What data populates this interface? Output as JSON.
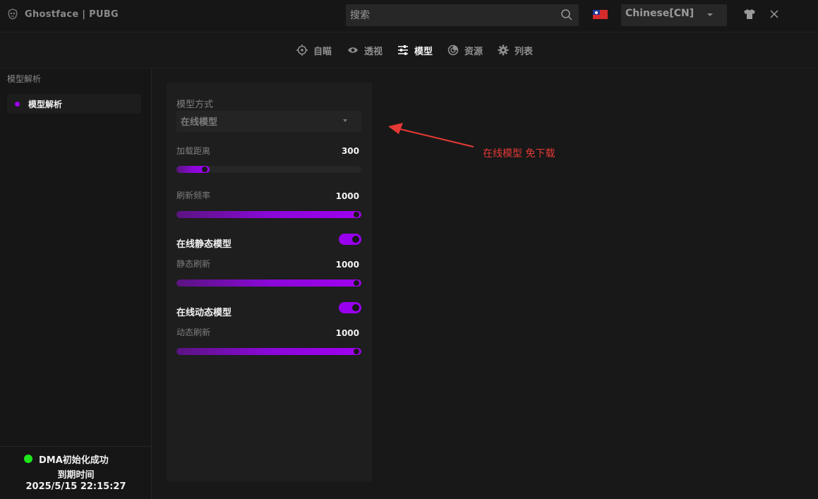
{
  "app": {
    "title": "Ghostface | PUBG"
  },
  "search": {
    "placeholder": "搜索"
  },
  "language": {
    "selected": "Chinese[CN]"
  },
  "nav": {
    "items": [
      {
        "label": "自瞄",
        "icon": "crosshair-icon",
        "active": false
      },
      {
        "label": "透视",
        "icon": "eye-icon",
        "active": false
      },
      {
        "label": "模型",
        "icon": "sliders-icon",
        "active": true
      },
      {
        "label": "资源",
        "icon": "radar-icon",
        "active": false
      },
      {
        "label": "列表",
        "icon": "gear-icon",
        "active": false
      }
    ]
  },
  "sidebar": {
    "heading": "模型解析",
    "items": [
      {
        "label": "模型解析",
        "active": true
      }
    ]
  },
  "status": {
    "text": "DMA初始化成功",
    "expire_label": "到期时间",
    "expire_value": "2025/5/15 22:15:27"
  },
  "settings": {
    "mode_label": "模型方式",
    "mode_value": "在线模型",
    "load_distance": {
      "label": "加载距离",
      "value": "300",
      "fraction": 0.18
    },
    "refresh_rate": {
      "label": "刷新频率",
      "value": "1000",
      "fraction": 1.0
    },
    "static_model": {
      "label": "在线静态模型",
      "enabled": true
    },
    "static_refresh": {
      "label": "静态刷新",
      "value": "1000",
      "fraction": 1.0
    },
    "dynamic_model": {
      "label": "在线动态模型",
      "enabled": true
    },
    "dynamic_refresh": {
      "label": "动态刷新",
      "value": "1000",
      "fraction": 1.0
    }
  },
  "annotation": {
    "text": "在线模型 免下载"
  },
  "colors": {
    "accent": "#a000f0",
    "status_ok": "#1ee51e",
    "annotation": "#e53935"
  }
}
